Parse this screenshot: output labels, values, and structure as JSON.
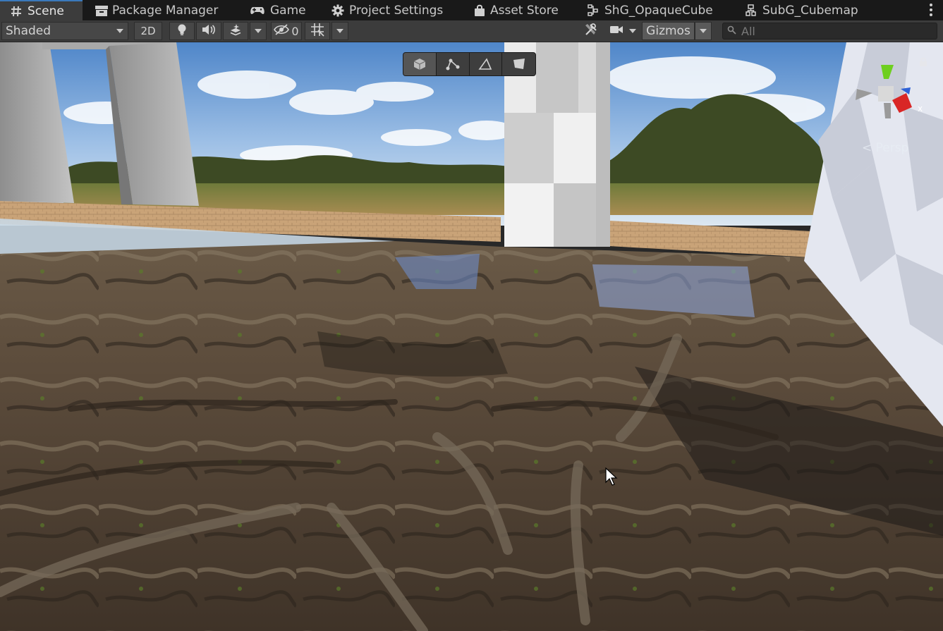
{
  "tabs": [
    {
      "label": "Scene",
      "icon": "grid-icon",
      "active": true
    },
    {
      "label": "Package Manager",
      "icon": "package-icon",
      "active": false
    },
    {
      "label": "Game",
      "icon": "gamepad-icon",
      "active": false
    },
    {
      "label": "Project Settings",
      "icon": "gear-icon",
      "active": false
    },
    {
      "label": "Asset Store",
      "icon": "shopping-bag-icon",
      "active": false
    },
    {
      "label": "ShG_OpaqueCube",
      "icon": "shader-graph-icon",
      "active": false
    },
    {
      "label": "SubG_Cubemap",
      "icon": "subgraph-icon",
      "active": false
    }
  ],
  "toolbar": {
    "draw_mode": "Shaded",
    "mode_2d": "2D",
    "hidden_count": "0",
    "gizmos_label": "Gizmos",
    "search_placeholder": "All"
  },
  "viewport": {
    "projection_label": "Persp",
    "overlay_tools": [
      "cube-icon",
      "vertex-snap-icon",
      "edge-icon",
      "face-icon"
    ],
    "gizmo_axis_label": "x"
  },
  "colors": {
    "tab_active_accent": "#3a79bb",
    "gizmo_y": "#6ecf1f",
    "gizmo_x": "#d92626",
    "gizmo_z": "#2f62d6"
  }
}
